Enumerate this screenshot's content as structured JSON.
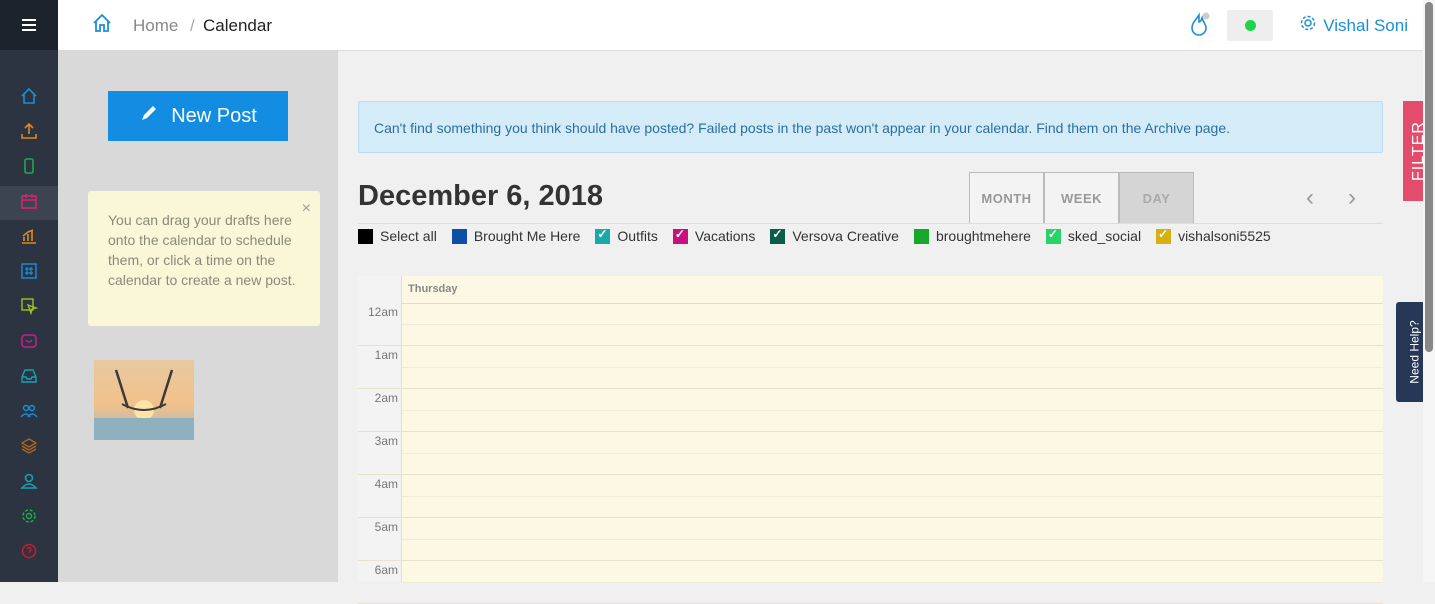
{
  "sidebar": {
    "icons": [
      {
        "name": "home-icon",
        "color": "#1b8fd6"
      },
      {
        "name": "upload-icon",
        "color": "#e28a1e"
      },
      {
        "name": "phone-icon",
        "color": "#1fa94a"
      },
      {
        "name": "calendar-icon",
        "color": "#d6246b"
      },
      {
        "name": "analytics-icon",
        "color": "#e28a1e"
      },
      {
        "name": "hashtag-icon",
        "color": "#1b8fd6"
      },
      {
        "name": "cursor-icon",
        "color": "#9bc21e"
      },
      {
        "name": "inbox-heart-icon",
        "color": "#c61e8a"
      },
      {
        "name": "tray-icon",
        "color": "#17a2b8"
      },
      {
        "name": "users-icon",
        "color": "#1b8fd6"
      },
      {
        "name": "layers-icon",
        "color": "#b5651d"
      },
      {
        "name": "user-icon",
        "color": "#17a2b8"
      },
      {
        "name": "settings-icon",
        "color": "#1fa94a"
      },
      {
        "name": "help-icon",
        "color": "#c41e2a"
      }
    ]
  },
  "breadcrumb": {
    "home": "Home",
    "separator": "/",
    "current": "Calendar"
  },
  "user": {
    "name": "Vishal Soni"
  },
  "status_color": "#1fd34a",
  "left": {
    "new_post_label": "New Post",
    "tip_text": "You can drag your drafts here onto the calendar to schedule them, or click a time on the calendar to create a new post.",
    "tip_close": "×"
  },
  "alert": "Can't find something you think should have posted? Failed posts in the past won't appear in your calendar. Find them on the Archive page.",
  "calendar": {
    "date": "December 6, 2018",
    "views": [
      "MONTH",
      "WEEK",
      "DAY"
    ],
    "active_view": "DAY",
    "day_label": "Thursday",
    "hours": [
      "12am",
      "1am",
      "2am",
      "3am",
      "4am",
      "5am",
      "6am"
    ]
  },
  "legend": [
    {
      "label": "Select all",
      "color": "#000000",
      "checked": false
    },
    {
      "label": "Brought Me Here",
      "color": "#0b4fa6",
      "checked": false
    },
    {
      "label": "Outfits",
      "color": "#19a9a9",
      "checked": true
    },
    {
      "label": "Vacations",
      "color": "#c8117f",
      "checked": true
    },
    {
      "label": "Versova Creative",
      "color": "#0a5d4a",
      "checked": true
    },
    {
      "label": "broughtmehere",
      "color": "#17a82b",
      "checked": false
    },
    {
      "label": "sked_social",
      "color": "#28d36a",
      "checked": true
    },
    {
      "label": "vishalsoni5525",
      "color": "#d4b10e",
      "checked": true
    }
  ],
  "filter_label": "FILTER",
  "help_label": "Need Help?"
}
